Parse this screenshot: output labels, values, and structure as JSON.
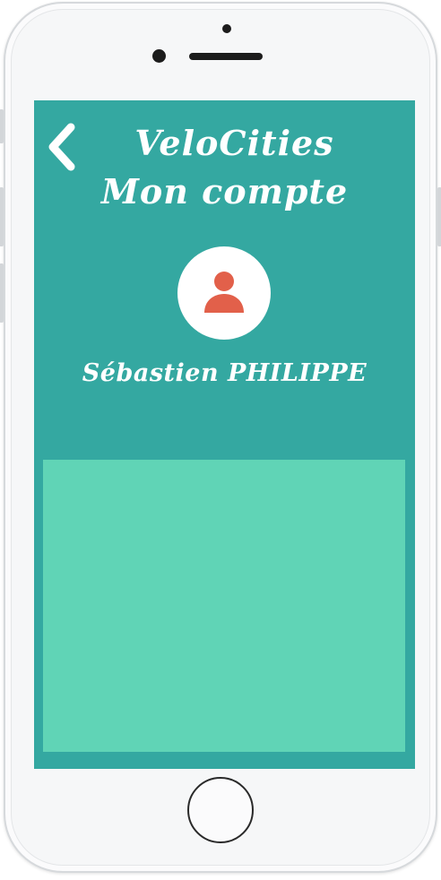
{
  "header": {
    "app_name": "VeloCities",
    "page_title": "Mon compte"
  },
  "profile": {
    "name": "Sébastien PHILIPPE",
    "avatar_icon": "user-icon"
  },
  "colors": {
    "header_bg": "#34a8a1",
    "panel_bg": "#60d4b6",
    "avatar_icon": "#e2604a",
    "text": "#ffffff"
  },
  "icons": {
    "back": "chevron-left-icon",
    "avatar": "user-icon"
  }
}
